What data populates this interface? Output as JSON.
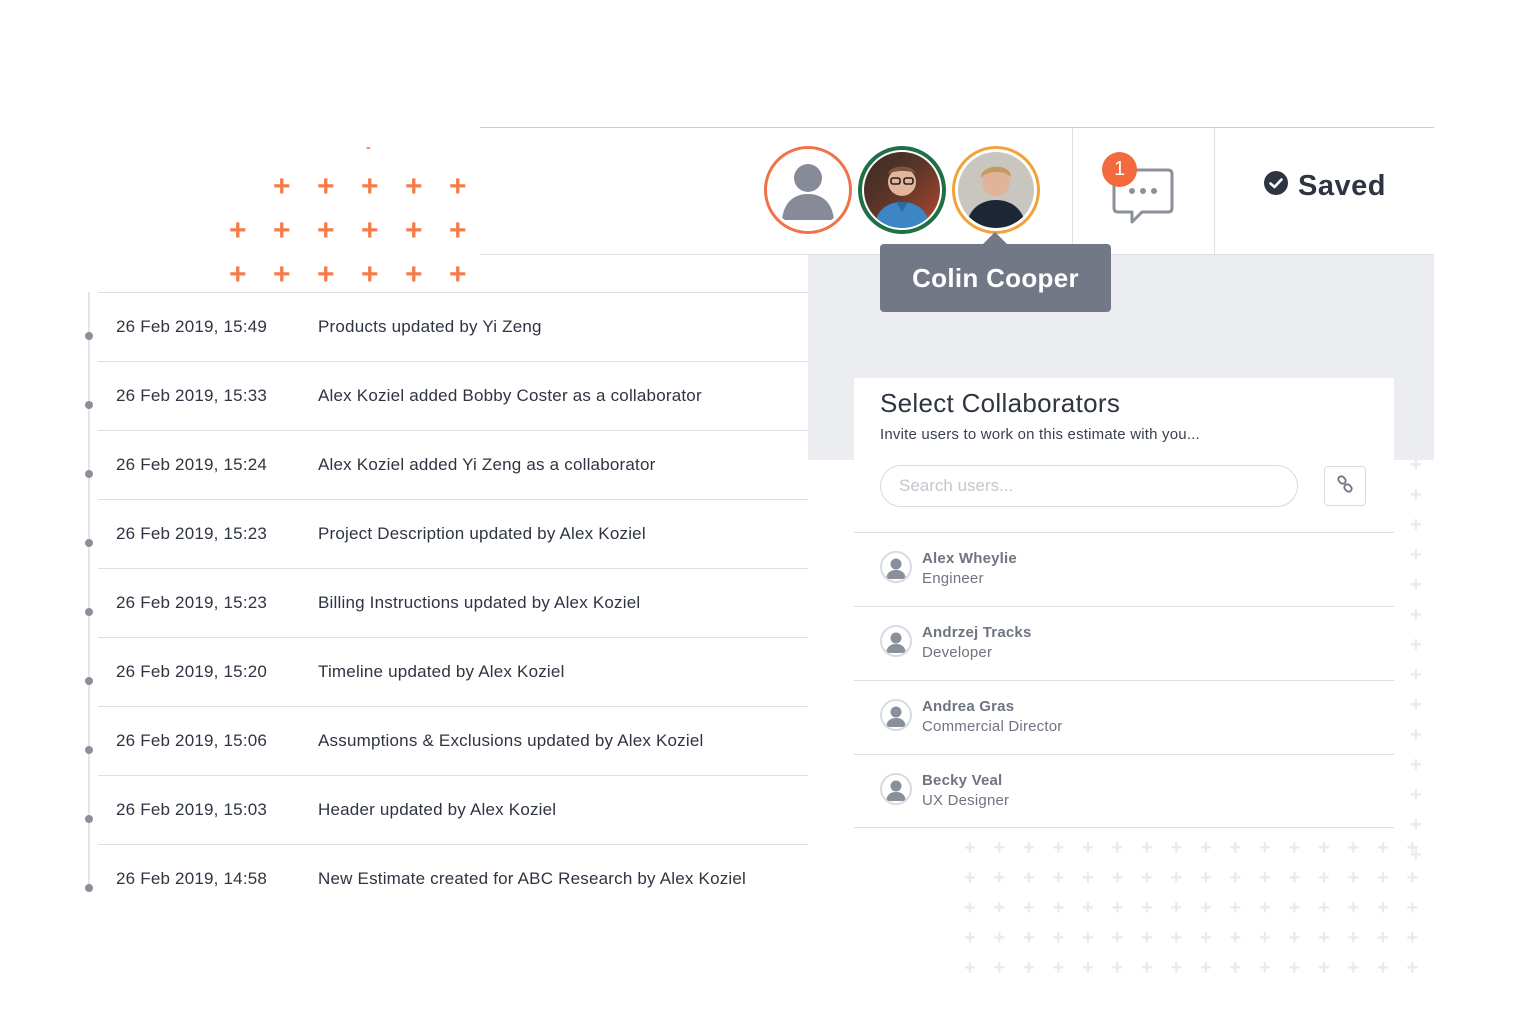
{
  "header": {
    "collaborators": [
      {
        "name": "",
        "ring_color": "#f0724a",
        "avatar": "default-user-icon"
      },
      {
        "name": "",
        "ring_color": "#1f6f47",
        "avatar": "photo-man-glasses"
      },
      {
        "name": "Colin Cooper",
        "ring_color": "#f1a33a",
        "avatar": "photo-man-blond"
      }
    ],
    "tooltip": "Colin Cooper",
    "comments_badge": "1",
    "saved_label": "Saved"
  },
  "activity": [
    {
      "date": "26 Feb 2019, 15:49",
      "desc": "Products updated by Yi Zeng"
    },
    {
      "date": "26 Feb 2019, 15:33",
      "desc": "Alex Koziel added Bobby Coster as a collaborator"
    },
    {
      "date": "26 Feb 2019, 15:24",
      "desc": "Alex Koziel added Yi Zeng as a collaborator"
    },
    {
      "date": "26 Feb 2019, 15:23",
      "desc": "Project Description updated by Alex Koziel"
    },
    {
      "date": "26 Feb 2019, 15:23",
      "desc": "Billing Instructions updated by Alex Koziel"
    },
    {
      "date": "26 Feb 2019, 15:20",
      "desc": "Timeline updated by Alex Koziel"
    },
    {
      "date": "26 Feb 2019, 15:06",
      "desc": "Assumptions & Exclusions updated by Alex Koziel"
    },
    {
      "date": "26 Feb 2019, 15:03",
      "desc": "Header updated by Alex Koziel"
    },
    {
      "date": "26 Feb 2019, 14:58",
      "desc": "New Estimate created for ABC Research by Alex Koziel"
    }
  ],
  "collab_panel": {
    "title": "Select Collaborators",
    "subtitle": "Invite users to work on this estimate with you...",
    "search_placeholder": "Search users...",
    "users": [
      {
        "name": "Alex Wheylie",
        "role": "Engineer"
      },
      {
        "name": "Andrzej Tracks",
        "role": "Developer"
      },
      {
        "name": "Andrea Gras",
        "role": "Commercial Director"
      },
      {
        "name": "Becky Veal",
        "role": "UX Designer"
      }
    ]
  },
  "colors": {
    "accent": "#f26a3d",
    "tooltip_bg": "#727886",
    "text": "#2f3442"
  }
}
